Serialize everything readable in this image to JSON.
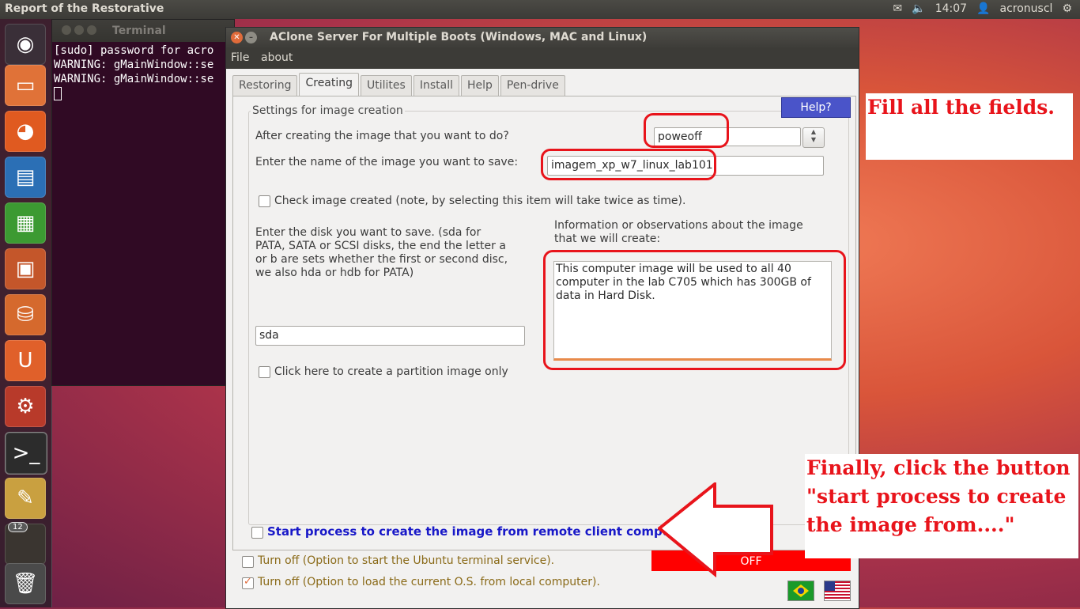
{
  "top_panel": {
    "title": "Report of the Restorative",
    "time": "14:07",
    "user": "acronuscl"
  },
  "launcher": {
    "items": [
      "ubuntu-dash",
      "files",
      "firefox",
      "writer",
      "calc",
      "impress",
      "software-center",
      "ubuntu-one",
      "system-settings",
      "terminal",
      "archive",
      "workspaces",
      "trash"
    ],
    "workspace_badge": "12"
  },
  "terminal": {
    "title": "Terminal",
    "lines": [
      "[sudo] password for acro",
      "WARNING: gMainWindow::se",
      "WARNING: gMainWindow::se"
    ]
  },
  "window": {
    "title": "AClone Server For Multiple Boots (Windows, MAC and Linux)",
    "menu": {
      "file": "File",
      "about": "about"
    },
    "tabs": [
      "Restoring",
      "Creating",
      "Utilites",
      "Install",
      "Help",
      "Pen-drive"
    ],
    "active_tab": "Creating",
    "group_title": "Settings for image creation",
    "help_button": "Help?",
    "after_label": "After creating the image that you want to do?",
    "after_value": "poweoff",
    "name_label": "Enter the name of the image you want to save:",
    "name_value": "imagem_xp_w7_linux_lab101",
    "check_image_label": "Check image created (note, by selecting this item will take twice as time).",
    "disk_label": "Enter the disk you want to save. (sda for PATA, SATA or SCSI disks, the end the letter a or b are sets whether the first or second disc, we also hda or hdb for PATA)",
    "disk_value": "sda",
    "obs_label": "Information or observations about the image that we will create:",
    "obs_value": "This computer image will be used to all 40 computer in the lab C705 which has 300GB of data in Hard Disk.",
    "partition_label": "Click here to create a partition image only",
    "start_label": "Start process to create the image from remote client computer.",
    "off_button": "OFF",
    "turnoff_terminal": "Turn off (Option to start the Ubuntu terminal service).",
    "turnoff_local": "Turn off (Option to load the current O.S. from local computer).",
    "turnoff_local_checked": true,
    "flags": [
      "brazil-flag",
      "usa-flag"
    ]
  },
  "annotations": {
    "note1": "Fill all the fields.",
    "note2_lines": [
      "Finally, click the button",
      "\"start process to create",
      "the image from....\""
    ]
  },
  "colors": {
    "annotation_red": "#e8141b",
    "start_blue": "#1818c8",
    "help_blue": "#4a54c9",
    "off_red": "#ff0000"
  }
}
